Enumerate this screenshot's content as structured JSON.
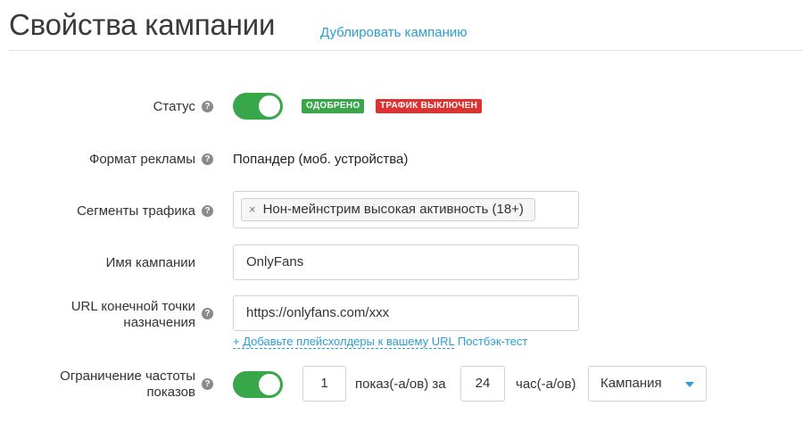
{
  "header": {
    "title": "Свойства кампании",
    "duplicate_link": "Дублировать кампанию"
  },
  "help_icon": "question-circle-icon",
  "status": {
    "label": "Статус",
    "toggle_on": true,
    "badges": {
      "approved": "ОДОБРЕНО",
      "traffic_off": "ТРАФИК ВЫКЛЮЧЕН"
    }
  },
  "ad_format": {
    "label": "Формат рекламы",
    "value": "Попандер (моб. устройства)"
  },
  "traffic_segments": {
    "label": "Сегменты трафика",
    "tag_remove": "×",
    "tag": "Нон-мейнстрим высокая активность (18+)"
  },
  "campaign_name": {
    "label": "Имя кампании",
    "value": "OnlyFans"
  },
  "destination_url": {
    "label_line1": "URL конечной точки",
    "label_line2": "назначения",
    "value": "https://onlyfans.com/xxx",
    "add_placeholders_link": "+ Добавьте плейсхолдеры к вашему URL",
    "postback_test_link": "Постбэк-тест"
  },
  "frequency_cap": {
    "label_line1": "Ограничение частоты",
    "label_line2": "показов",
    "toggle_on": true,
    "impressions_value": "1",
    "impressions_text": "показ(-а/ов) за",
    "hours_value": "24",
    "hours_text": "час(-а/ов)",
    "scope_selected": "Кампания"
  },
  "colors": {
    "accent": "#2a9fd6",
    "toggle_green": "#37a74a",
    "badge_red": "#e03131"
  }
}
